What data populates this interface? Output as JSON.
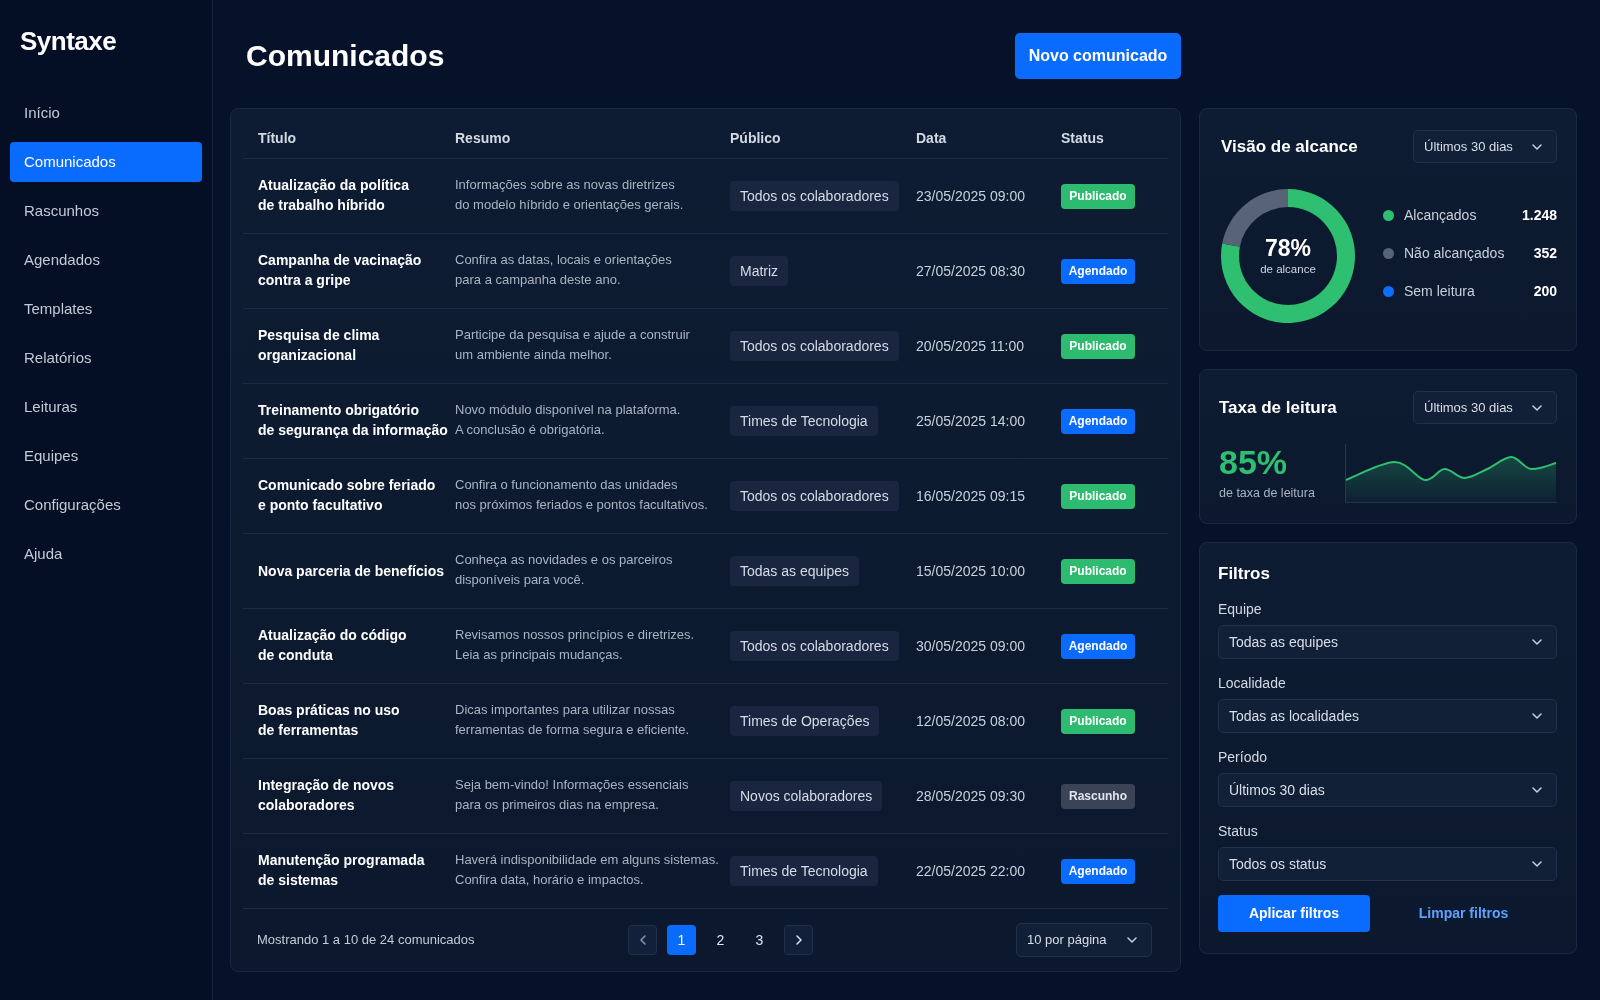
{
  "sidebar": {
    "logo": "Syntaxe",
    "items": [
      {
        "label": "Início",
        "selected": false
      },
      {
        "label": "Comunicados",
        "selected": true
      },
      {
        "label": "Rascunhos",
        "selected": false
      },
      {
        "label": "Agendados",
        "selected": false
      },
      {
        "label": "Templates",
        "selected": false
      },
      {
        "label": "Relatórios",
        "selected": false
      },
      {
        "label": "Leituras",
        "selected": false
      },
      {
        "label": "Equipes",
        "selected": false
      },
      {
        "label": "Configurações",
        "selected": false
      },
      {
        "label": "Ajuda",
        "selected": false
      }
    ]
  },
  "header": {
    "title": "Comunicados",
    "new_button": "Novo comunicado"
  },
  "table": {
    "columns": [
      "Título",
      "Resumo",
      "Público",
      "Data",
      "Status"
    ],
    "rows": [
      {
        "title": "Atualização da política\nde trabalho híbrido",
        "summary": "Informações sobre as novas diretrizes\ndo modelo híbrido e orientações gerais.",
        "audience": "Todos os colaboradores",
        "date": "23/05/2025 09:00",
        "status": {
          "label": "Publicado",
          "kind": "published"
        }
      },
      {
        "title": "Campanha de vacinação\ncontra a gripe",
        "summary": "Confira as datas, locais e orientações\npara a campanha deste ano.",
        "audience": "Matriz",
        "date": "27/05/2025 08:30",
        "status": {
          "label": "Agendado",
          "kind": "scheduled"
        }
      },
      {
        "title": "Pesquisa de clima\norganizacional",
        "summary": "Participe da pesquisa e ajude a construir\num ambiente ainda melhor.",
        "audience": "Todos os colaboradores",
        "date": "20/05/2025 11:00",
        "status": {
          "label": "Publicado",
          "kind": "published"
        }
      },
      {
        "title": "Treinamento obrigatório\nde segurança da informação",
        "summary": "Novo módulo disponível na plataforma.\nA conclusão é obrigatória.",
        "audience": "Times de Tecnologia",
        "date": "25/05/2025 14:00",
        "status": {
          "label": "Agendado",
          "kind": "scheduled"
        }
      },
      {
        "title": "Comunicado sobre feriado\ne ponto facultativo",
        "summary": "Confira o funcionamento das unidades\nnos próximos feriados e pontos facultativos.",
        "audience": "Todos os colaboradores",
        "date": "16/05/2025 09:15",
        "status": {
          "label": "Publicado",
          "kind": "published"
        }
      },
      {
        "title": "Nova parceria de benefícios",
        "summary": "Conheça as novidades e os parceiros\ndisponíveis para você.",
        "audience": "Todas as equipes",
        "date": "15/05/2025 10:00",
        "status": {
          "label": "Publicado",
          "kind": "published"
        }
      },
      {
        "title": "Atualização do código\nde conduta",
        "summary": "Revisamos nossos princípios e diretrizes.\nLeia as principais mudanças.",
        "audience": "Todos os colaboradores",
        "date": "30/05/2025 09:00",
        "status": {
          "label": "Agendado",
          "kind": "scheduled"
        }
      },
      {
        "title": "Boas práticas no uso\nde ferramentas",
        "summary": "Dicas importantes para utilizar nossas\nferramentas de forma segura e eficiente.",
        "audience": "Times de Operações",
        "date": "12/05/2025 08:00",
        "status": {
          "label": "Publicado",
          "kind": "published"
        }
      },
      {
        "title": "Integração de novos\ncolaboradores",
        "summary": "Seja bem-vindo! Informações essenciais\npara os primeiros dias na empresa.",
        "audience": "Novos colaboradores",
        "date": "28/05/2025 09:30",
        "status": {
          "label": "Rascunho",
          "kind": "draft"
        }
      },
      {
        "title": "Manutenção programada\nde sistemas",
        "summary": "Haverá indisponibilidade em alguns sistemas.\nConfira data, horário e impactos.",
        "audience": "Times de Tecnologia",
        "date": "22/05/2025 22:00",
        "status": {
          "label": "Agendado",
          "kind": "scheduled"
        }
      }
    ]
  },
  "pagination": {
    "summary": "Mostrando 1 a 10 de 24 comunicados",
    "pages": [
      {
        "label": "1",
        "selected": true
      },
      {
        "label": "2",
        "selected": false
      },
      {
        "label": "3",
        "selected": false
      }
    ],
    "per_page": "10 por página"
  },
  "reach": {
    "title": "Visão de alcance",
    "period": "Últimos 30 dias",
    "center_value": "78%",
    "center_label": "de alcance",
    "chart_data": {
      "type": "donut",
      "categories": [
        "Alcançados",
        "Não alcançados"
      ],
      "values": [
        78,
        22
      ]
    },
    "legend": [
      {
        "value": "1.248",
        "color": "#2fbf71"
      },
      {
        "value": "352",
        "color": "#586378"
      },
      {
        "label": "Sem leitura",
        "value": "200",
        "color": "#0d6efd"
      }
    ]
  },
  "read_rate": {
    "title": "Taxa de leitura",
    "period": "Últimos 30 dias",
    "value": "85%",
    "caption": "de taxa de leitura"
  },
  "filters": {
    "title": "Filtros",
    "fields": [
      {
        "label": "Equipe",
        "value": "Todas as equipes"
      },
      {
        "label": "Localidade",
        "value": "Todas as localidades"
      },
      {
        "label": "Período",
        "value": "Últimos 30 dias"
      },
      {
        "label": "Status",
        "value": "Todos os status"
      }
    ],
    "apply_button": "Aplicar filtros",
    "clear_link": "Limpar filtros"
  }
}
